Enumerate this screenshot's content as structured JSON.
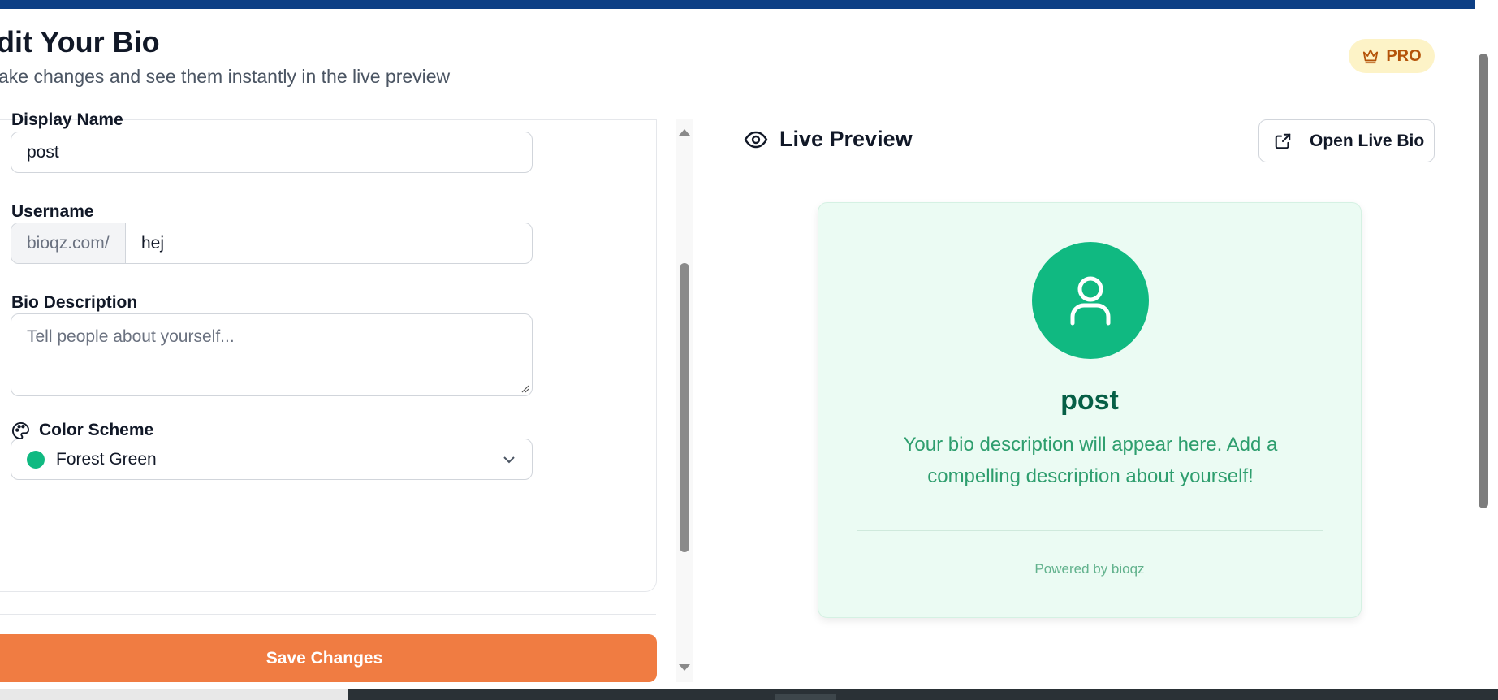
{
  "header": {
    "title": "dit Your Bio",
    "subtitle": "ake changes and see them instantly in the live preview",
    "badge": "PRO",
    "badge_icon": "crown-icon"
  },
  "form": {
    "display_name": {
      "label": "Display Name",
      "value": "post"
    },
    "username": {
      "label": "Username",
      "prefix": "bioqz.com/",
      "value": "hej"
    },
    "bio": {
      "label": "Bio Description",
      "placeholder": "Tell people about yourself..."
    },
    "color_scheme": {
      "label": "Color Scheme",
      "icon": "palette-icon",
      "selected": "Forest Green",
      "swatch": "#10b981"
    },
    "save_label": "Save Changes"
  },
  "preview": {
    "title": "Live Preview",
    "title_icon": "eye-icon",
    "open_button": "Open Live Bio",
    "card": {
      "name": "post",
      "description": "Your bio description will appear here. Add a compelling description about yourself!",
      "footer": "Powered by bioqz"
    }
  },
  "colors": {
    "accent": "#f07c42",
    "brand_bar": "#0d3f85",
    "scheme_green": "#10b981",
    "card_bg": "#ebfbf3",
    "pro_bg": "#fdf3c7"
  }
}
